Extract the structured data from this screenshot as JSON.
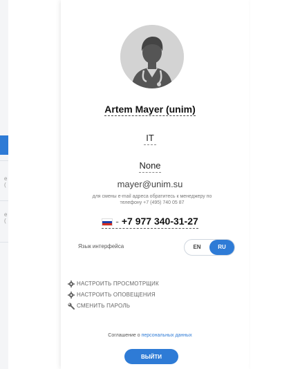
{
  "background": {
    "ghost_fragment_1": "e (",
    "ghost_fragment_2": "e ("
  },
  "profile": {
    "name": "Artem Mayer (unim)",
    "department": "IT",
    "position": "None",
    "email": "mayer@unim.su",
    "email_note": "для смены e-mail адреса обратитесь к менеджеру по телефону +7 (495) 740 05 87",
    "phone_prefix": "-",
    "phone": "+7 977 340-31-27",
    "flag_colors": [
      "#ffffff",
      "#1c3fa8",
      "#d52b1e"
    ]
  },
  "language": {
    "label": "Язык интерфейса",
    "options": [
      "EN",
      "RU"
    ],
    "selected": "RU"
  },
  "links": {
    "viewer": "НАСТРОИТЬ ПРОСМОТРЩИК",
    "notifications": "НАСТРОИТЬ ОПОВЕЩЕНИЯ",
    "password": "СМЕНИТЬ ПАРОЛЬ"
  },
  "footer": {
    "agreement_prefix": "Соглашение о",
    "agreement_link": "персональных данных",
    "logout_label": "ВЫЙТИ"
  },
  "colors": {
    "accent": "#2e7bd6",
    "avatar_bg": "#d3d3d3"
  }
}
